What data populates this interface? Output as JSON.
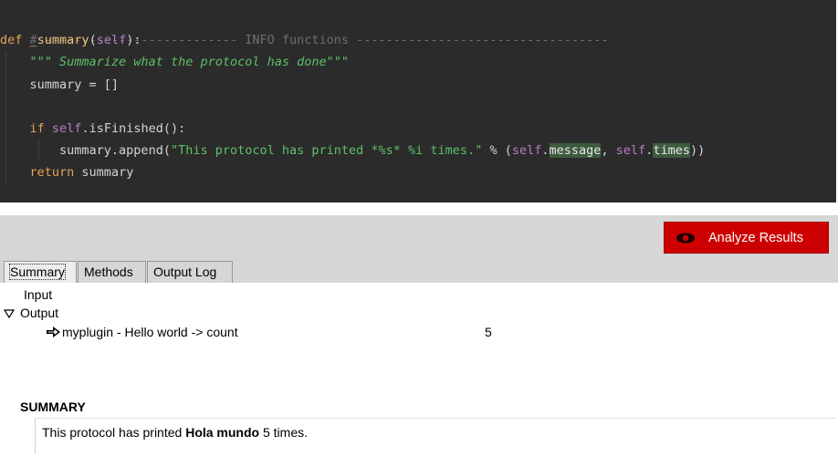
{
  "code": {
    "comment_line": "# -------------------------- INFO functions ----------------------------------",
    "def_kw": "def",
    "func_name": "_summary",
    "func_open": "(",
    "func_self": "self",
    "func_close": "):",
    "docstring": "\"\"\" Summarize what the protocol has done\"\"\"",
    "assign": "summary = []",
    "if_kw": "if",
    "if_self": "self",
    "if_rest": ".isFinished():",
    "append_call": "summary.append(",
    "append_string": "\"This protocol has printed *%s* %i times.\"",
    "append_op": " % (",
    "self_a": "self",
    "dot_a": ".",
    "attr_message": "message",
    "comma": ", ",
    "self_b": "self",
    "dot_b": ".",
    "attr_times": "times",
    "close": "))",
    "return_kw": "return",
    "return_val": " summary"
  },
  "toolbar": {
    "analyze_label": "Analyze Results",
    "analyze_icon": "eye-icon",
    "accent": "#cc0000"
  },
  "tabs": [
    {
      "label": "Summary",
      "active": true
    },
    {
      "label": "Methods",
      "active": false
    },
    {
      "label": "Output Log",
      "active": false
    }
  ],
  "tree": {
    "input_label": "Input",
    "output_label": "Output",
    "output_expanded": true,
    "output_item_label": "myplugin - Hello world -> count",
    "output_item_value": "5",
    "output_item_icon": "arrow-right-icon"
  },
  "summary": {
    "title": "SUMMARY",
    "text_before": "This protocol has printed ",
    "text_bold": "Hola mundo",
    "text_after": " 5 times."
  }
}
